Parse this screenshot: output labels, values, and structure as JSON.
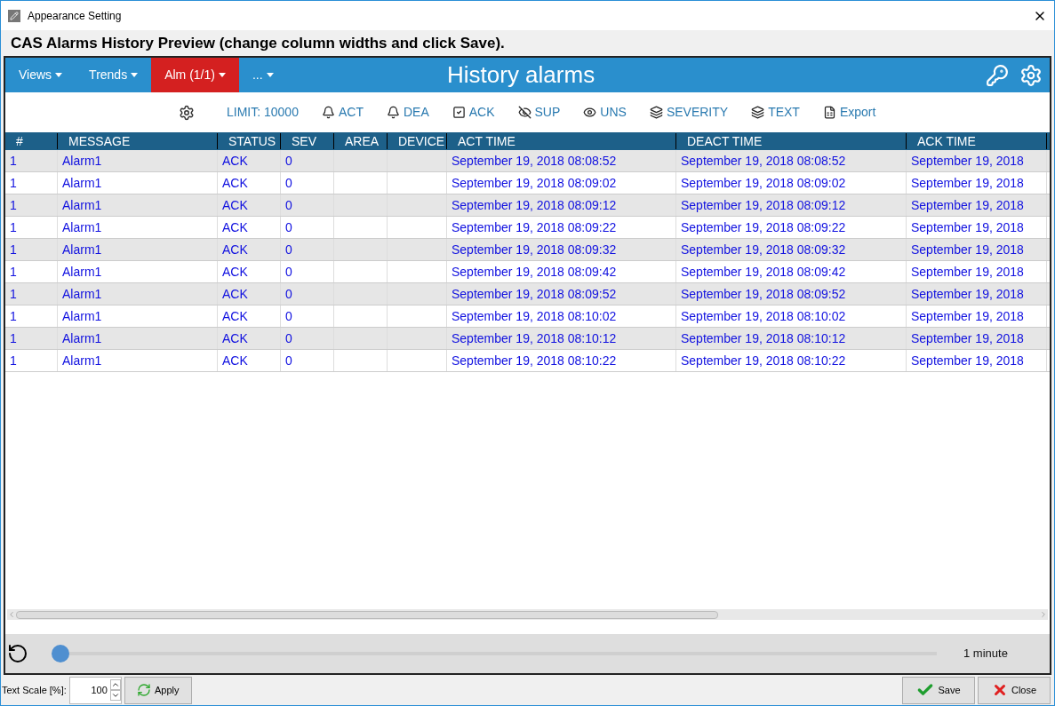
{
  "window": {
    "title": "Appearance Setting"
  },
  "heading": "CAS Alarms History Preview (change column widths and click Save).",
  "nav": {
    "tabs": [
      {
        "label": "Views",
        "selected": false
      },
      {
        "label": "Trends",
        "selected": false
      },
      {
        "label": "Alm (1/1)",
        "selected": true
      },
      {
        "label": "...",
        "selected": false
      }
    ],
    "title": "History alarms"
  },
  "toolbar": [
    {
      "kind": "gear"
    },
    {
      "kind": "text",
      "label": "LIMIT: 10000"
    },
    {
      "kind": "bell",
      "label": "ACT"
    },
    {
      "kind": "bell",
      "label": "DEA"
    },
    {
      "kind": "check",
      "label": "ACK"
    },
    {
      "kind": "eye-off",
      "label": "SUP"
    },
    {
      "kind": "eye",
      "label": "UNS"
    },
    {
      "kind": "layers",
      "label": "SEVERITY"
    },
    {
      "kind": "layers",
      "label": "TEXT"
    },
    {
      "kind": "xls",
      "label": "Export"
    }
  ],
  "table": {
    "columns": [
      "#",
      "MESSAGE",
      "STATUS",
      "SEV",
      "AREA",
      "DEVICE",
      "ACT TIME",
      "DEACT TIME",
      "ACK TIME"
    ],
    "rows": [
      [
        "1",
        "Alarm1",
        "ACK",
        "0",
        "",
        "",
        "September 19, 2018 08:08:52",
        "September 19, 2018 08:08:52",
        "September 19, 2018"
      ],
      [
        "1",
        "Alarm1",
        "ACK",
        "0",
        "",
        "",
        "September 19, 2018 08:09:02",
        "September 19, 2018 08:09:02",
        "September 19, 2018"
      ],
      [
        "1",
        "Alarm1",
        "ACK",
        "0",
        "",
        "",
        "September 19, 2018 08:09:12",
        "September 19, 2018 08:09:12",
        "September 19, 2018"
      ],
      [
        "1",
        "Alarm1",
        "ACK",
        "0",
        "",
        "",
        "September 19, 2018 08:09:22",
        "September 19, 2018 08:09:22",
        "September 19, 2018"
      ],
      [
        "1",
        "Alarm1",
        "ACK",
        "0",
        "",
        "",
        "September 19, 2018 08:09:32",
        "September 19, 2018 08:09:32",
        "September 19, 2018"
      ],
      [
        "1",
        "Alarm1",
        "ACK",
        "0",
        "",
        "",
        "September 19, 2018 08:09:42",
        "September 19, 2018 08:09:42",
        "September 19, 2018"
      ],
      [
        "1",
        "Alarm1",
        "ACK",
        "0",
        "",
        "",
        "September 19, 2018 08:09:52",
        "September 19, 2018 08:09:52",
        "September 19, 2018"
      ],
      [
        "1",
        "Alarm1",
        "ACK",
        "0",
        "",
        "",
        "September 19, 2018 08:10:02",
        "September 19, 2018 08:10:02",
        "September 19, 2018"
      ],
      [
        "1",
        "Alarm1",
        "ACK",
        "0",
        "",
        "",
        "September 19, 2018 08:10:12",
        "September 19, 2018 08:10:12",
        "September 19, 2018"
      ],
      [
        "1",
        "Alarm1",
        "ACK",
        "0",
        "",
        "",
        "September 19, 2018 08:10:22",
        "September 19, 2018 08:10:22",
        "September 19, 2018"
      ]
    ]
  },
  "timeline": {
    "level": 0,
    "reading": "1 minute"
  },
  "footer": {
    "scale_label": "Text Scale [%]:",
    "scale_value": "100",
    "apply": "Apply",
    "save": "Save",
    "close": "Close"
  }
}
